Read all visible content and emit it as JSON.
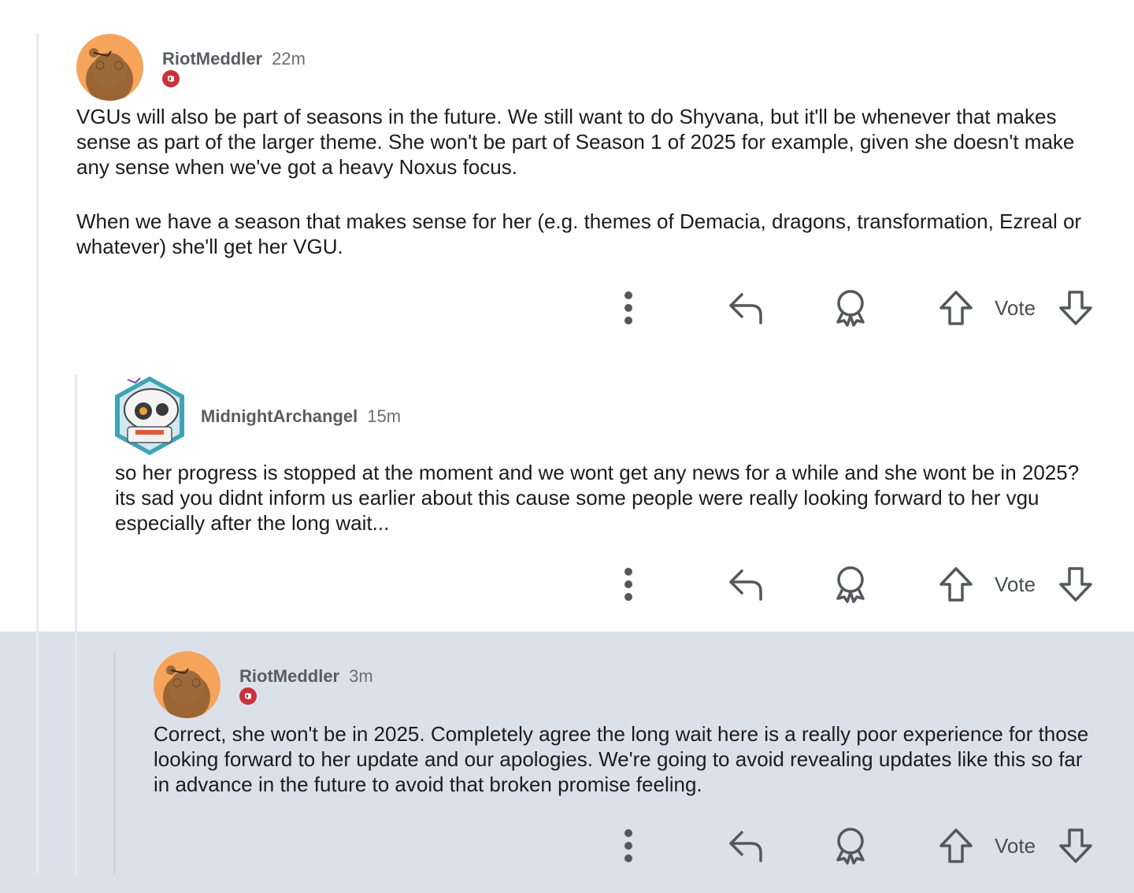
{
  "comments": [
    {
      "username": "RiotMeddler",
      "time": "22m",
      "has_flair": true,
      "paragraphs": [
        "VGUs will also be part of seasons in the future. We still want to do Shyvana, but it'll be whenever that makes sense as part of the larger theme. She won't be part of Season 1 of 2025 for example, given she doesn't make any sense when we've got a heavy Noxus focus.",
        "When we have a season that makes sense for her (e.g. themes of Demacia, dragons, transformation, Ezreal or whatever) she'll get her VGU."
      ],
      "vote_label": "Vote"
    },
    {
      "username": "MidnightArchangel",
      "time": "15m",
      "has_flair": false,
      "paragraphs": [
        "so her progress is stopped at the moment and we wont get any news for a while and she wont be in 2025? its sad you didnt inform us earlier about this cause some people were really looking forward to her vgu especially after the long wait..."
      ],
      "vote_label": "Vote"
    },
    {
      "username": "RiotMeddler",
      "time": "3m",
      "has_flair": true,
      "paragraphs": [
        "Correct, she won't be in 2025. Completely agree the long wait here is a really poor experience for those looking forward to her update and our apologies. We're going to avoid revealing updates like this so far in advance in the future to avoid that broken promise feeling."
      ],
      "vote_label": "Vote"
    }
  ],
  "colors": {
    "highlight_bg": "#dbe1ea",
    "flair_red": "#c8323c",
    "avatar_orange": "#f6a45c",
    "icon_gray": "#55585b"
  },
  "icons": [
    "more-options-icon",
    "reply-icon",
    "award-icon",
    "upvote-icon",
    "downvote-icon",
    "flair-icon"
  ]
}
